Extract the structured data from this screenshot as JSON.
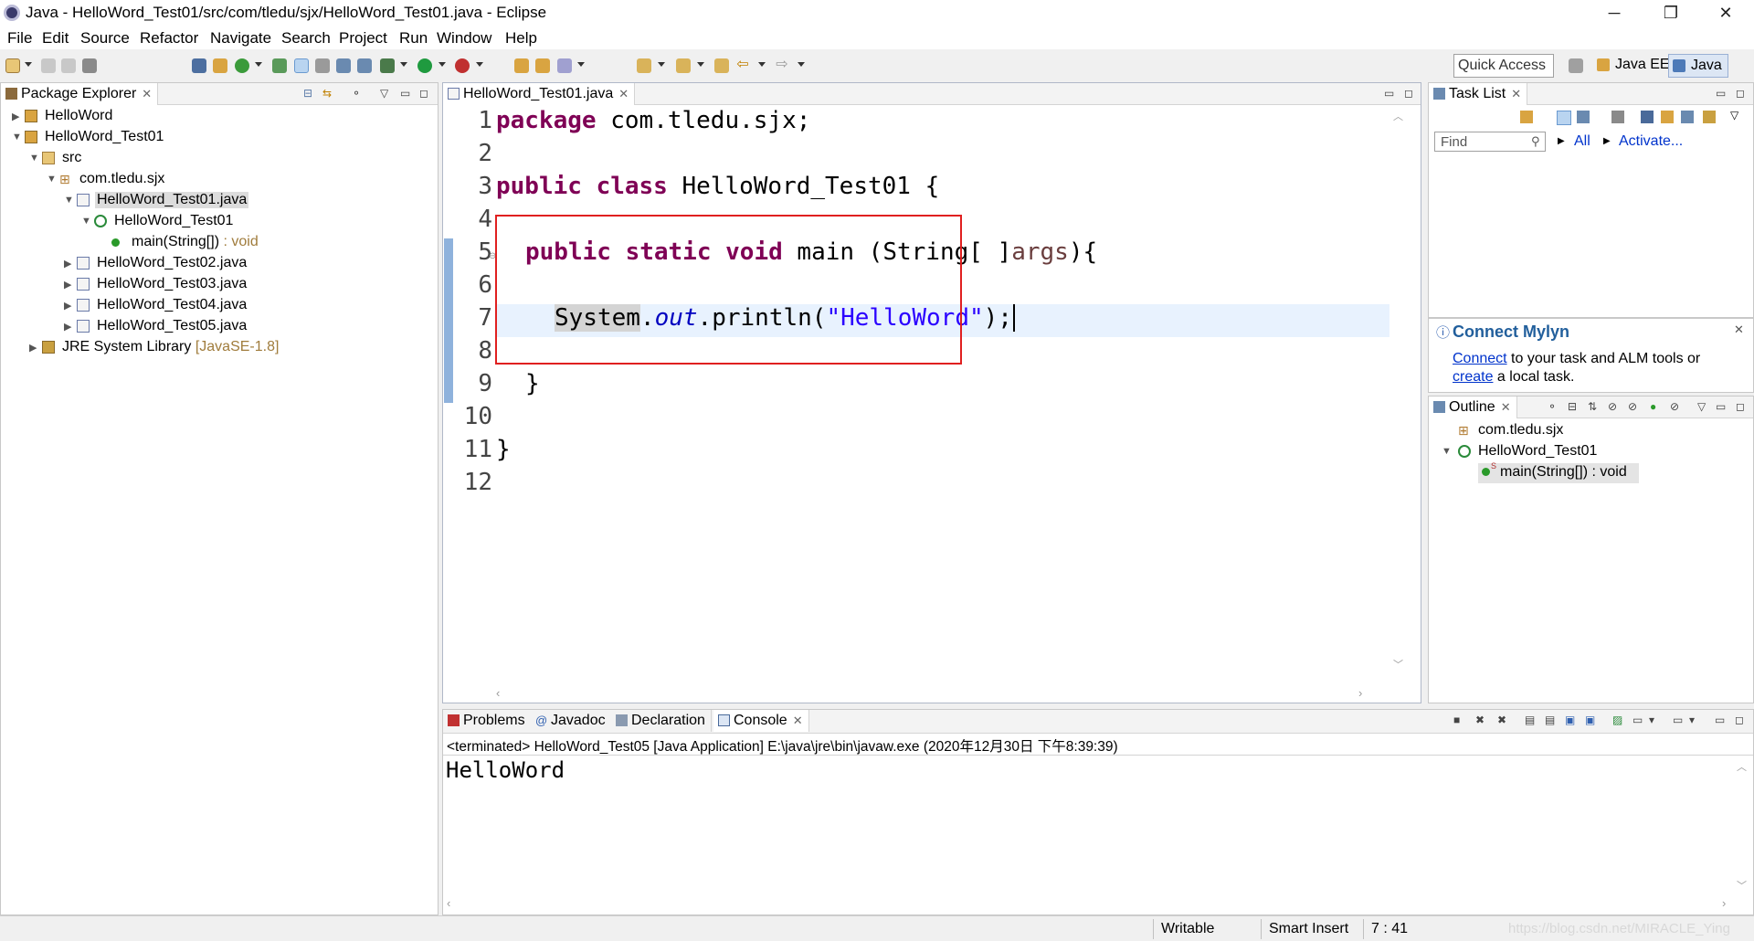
{
  "window": {
    "title": "Java - HelloWord_Test01/src/com/tledu/sjx/HelloWord_Test01.java - Eclipse",
    "minimize": "─",
    "restore": "❐",
    "close": "✕"
  },
  "menu": [
    "File",
    "Edit",
    "Source",
    "Refactor",
    "Navigate",
    "Search",
    "Project",
    "Run",
    "Window",
    "Help"
  ],
  "toolbar": {
    "quick_access_placeholder": "Quick Access",
    "perspectives": [
      "Java EE",
      "Java"
    ]
  },
  "package_explorer": {
    "tab_label": "Package Explorer",
    "tree": [
      {
        "label": "HelloWord",
        "depth": 0,
        "expanded": false,
        "icon": "project-icon"
      },
      {
        "label": "HelloWord_Test01",
        "depth": 0,
        "expanded": true,
        "icon": "project-icon"
      },
      {
        "label": "src",
        "depth": 1,
        "expanded": true,
        "icon": "source-folder-icon"
      },
      {
        "label": "com.tledu.sjx",
        "depth": 2,
        "expanded": true,
        "icon": "package-icon"
      },
      {
        "label": "HelloWord_Test01.java",
        "depth": 3,
        "expanded": true,
        "icon": "java-file-icon",
        "selected": true
      },
      {
        "label": "HelloWord_Test01",
        "depth": 4,
        "expanded": true,
        "icon": "class-icon"
      },
      {
        "label": "main(String[])",
        "decor": " : void",
        "depth": 5,
        "icon": "method-icon"
      },
      {
        "label": "HelloWord_Test02.java",
        "depth": 3,
        "expanded": false,
        "icon": "java-file-icon"
      },
      {
        "label": "HelloWord_Test03.java",
        "depth": 3,
        "expanded": false,
        "icon": "java-file-icon"
      },
      {
        "label": "HelloWord_Test04.java",
        "depth": 3,
        "expanded": false,
        "icon": "java-file-icon"
      },
      {
        "label": "HelloWord_Test05.java",
        "depth": 3,
        "expanded": false,
        "icon": "java-file-icon"
      },
      {
        "label": "JRE System Library",
        "decor": " [JavaSE-1.8]",
        "depth": 1,
        "expanded": false,
        "icon": "library-icon"
      }
    ]
  },
  "editor": {
    "tab_label": "HelloWord_Test01.java",
    "lines": [
      "1",
      "2",
      "3",
      "4",
      "5",
      "6",
      "7",
      "8",
      "9",
      "10",
      "11",
      "12"
    ],
    "code": {
      "l1_kw": "package",
      "l1_rest": " com.tledu.sjx;",
      "l3_kw": "public class",
      "l3_rest": " HelloWord_Test01 {",
      "l5_kw": "public static void",
      "l5_rest1": " main (String[ ]",
      "l5_args": "args",
      "l5_rest2": "){",
      "l7_sys": "System",
      "l7_dot": ".",
      "l7_out": "out",
      "l7_call": ".println(",
      "l7_str": "\"HelloWord\"",
      "l7_end": ");",
      "l9": "}",
      "l11": "}"
    }
  },
  "task_list": {
    "tab_label": "Task List",
    "find_placeholder": "Find",
    "all_label": "All",
    "activate_label": "Activate..."
  },
  "mylyn": {
    "title": "Connect Mylyn",
    "connect_link": "Connect",
    "text1": " to your task and ALM tools or",
    "create_link": "create",
    "text2": " a local task."
  },
  "outline": {
    "tab_label": "Outline",
    "items": [
      {
        "label": "com.tledu.sjx",
        "icon": "package-icon"
      },
      {
        "label": "HelloWord_Test01",
        "icon": "class-icon"
      },
      {
        "label": "main(String[]) : void",
        "icon": "method-icon"
      }
    ]
  },
  "bottom_tabs": [
    "Problems",
    "Javadoc",
    "Declaration",
    "Console"
  ],
  "console": {
    "header": "<terminated> HelloWord_Test05 [Java Application] E:\\java\\jre\\bin\\javaw.exe (2020年12月30日 下午8:39:39)",
    "output": "HelloWord"
  },
  "status": {
    "writable": "Writable",
    "insert_mode": "Smart Insert",
    "position": "7 : 41",
    "watermark": "https://blog.csdn.net/MIRACLE_Ying"
  }
}
